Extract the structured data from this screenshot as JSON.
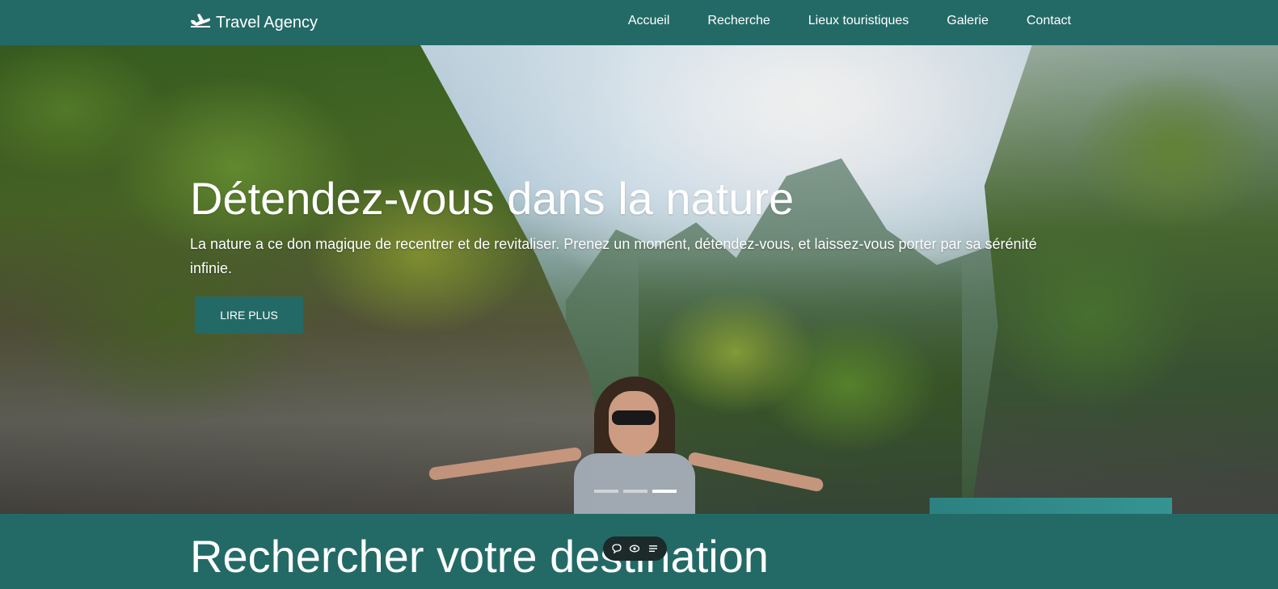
{
  "navbar": {
    "brand": "Travel Agency",
    "brand_icon": "plane-icon",
    "links": [
      "Accueil",
      "Recherche",
      "Lieux touristiques",
      "Galerie",
      "Contact"
    ]
  },
  "hero": {
    "title": "Détendez-vous dans la nature",
    "text": "La nature a ce don magique de recentrer et de revitaliser. Prenez un moment, détendez-vous, et laissez-vous porter par sa sérénité infinie.",
    "button_label": "LIRE PLUS",
    "slide_count": 3,
    "active_slide": 3
  },
  "search": {
    "title": "Rechercher votre destination"
  },
  "toolbar": {
    "icons": [
      "comment-icon",
      "eye-icon",
      "menu-icon"
    ]
  },
  "colors": {
    "primary": "#236a67",
    "text": "#ffffff"
  }
}
